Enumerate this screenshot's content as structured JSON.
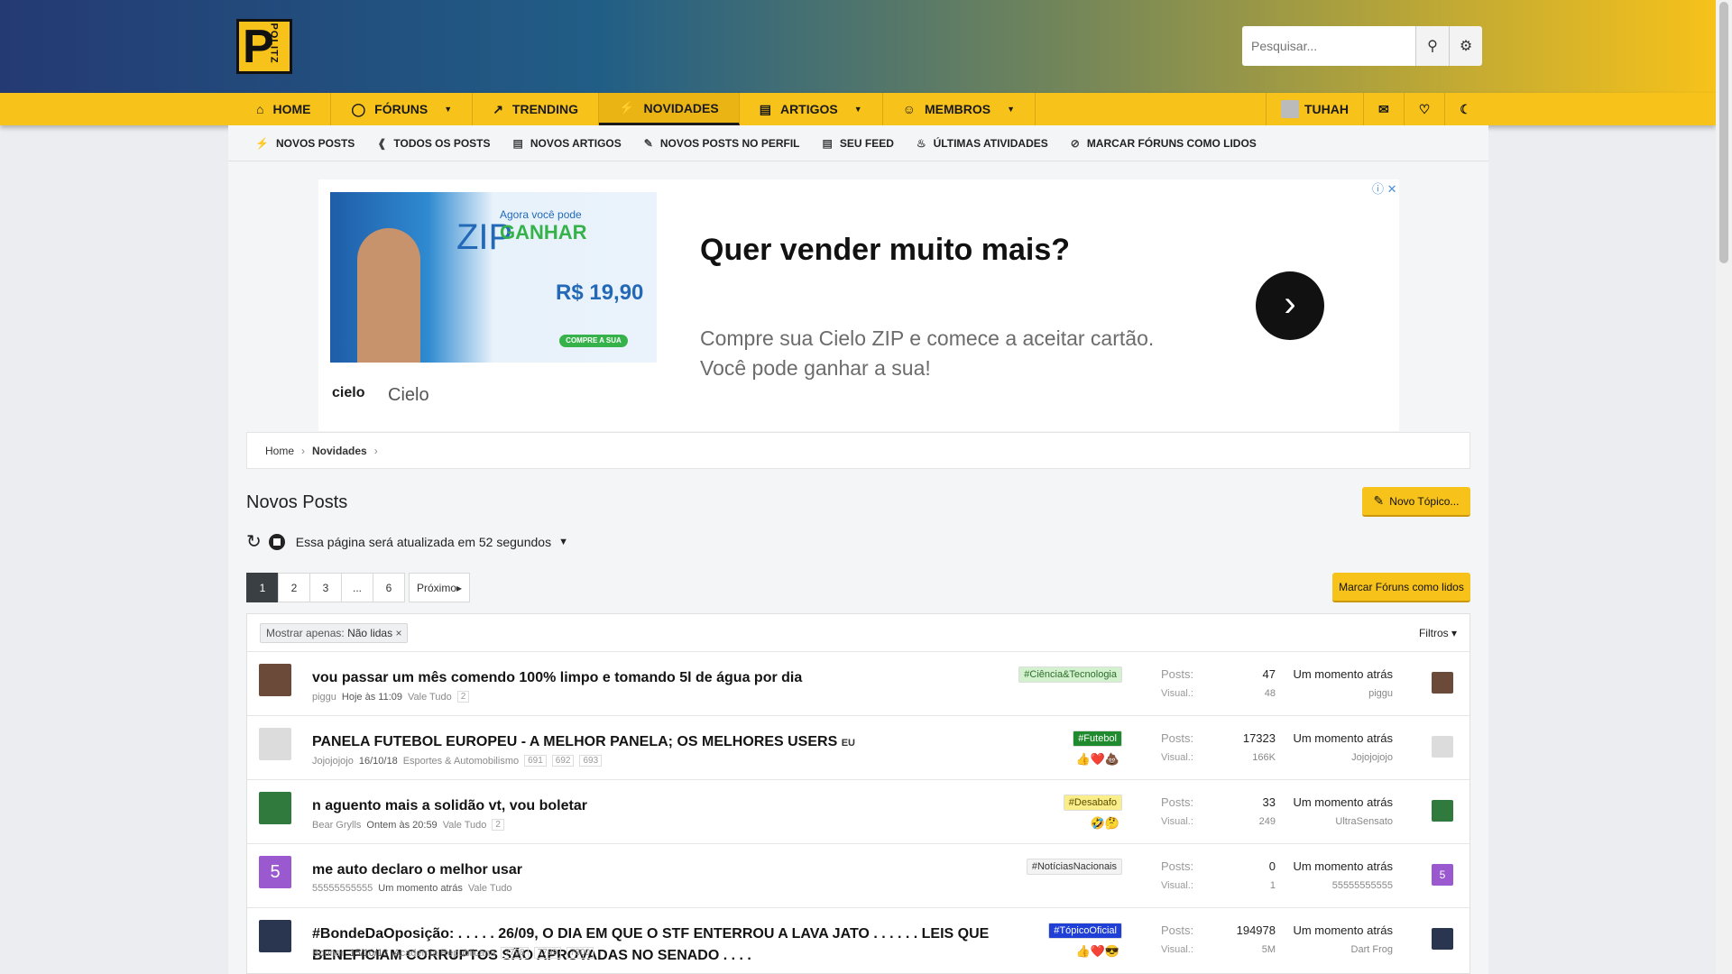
{
  "header": {
    "logo_letter": "P",
    "logo_text": "POLITZ",
    "search_placeholder": "Pesquisar...",
    "gradient_colors": [
      "#243a73",
      "#215e86",
      "#f7c21a"
    ]
  },
  "nav": {
    "items": [
      {
        "label": "HOME",
        "icon": "home-icon"
      },
      {
        "label": "FÓRUNS",
        "icon": "chat-icon"
      },
      {
        "label": "TRENDING",
        "icon": "chart-icon"
      },
      {
        "label": "NOVIDADES",
        "icon": "bolt-icon"
      },
      {
        "label": "ARTIGOS",
        "icon": "document-icon"
      },
      {
        "label": "MEMBROS",
        "icon": "users-icon"
      }
    ],
    "user": "TUHAH"
  },
  "subnav": [
    "NOVOS POSTS",
    "TODOS OS POSTS",
    "NOVOS ARTIGOS",
    "NOVOS POSTS NO PERFIL",
    "SEU FEED",
    "ÚLTIMAS ATIVIDADES",
    "MARCAR FÓRUNS COMO LIDOS"
  ],
  "ad": {
    "title": "Quer vender muito mais?",
    "description": "Compre sua Cielo ZIP e comece a aceitar cartão. Você pode ganhar a sua!",
    "brand_logo": "cielo",
    "brand": "Cielo",
    "img_zip": "ZIP",
    "img_line1": "Agora você pode",
    "img_ganhar": "GANHAR",
    "img_price": "R$ 19,90",
    "img_button": "COMPRE A SUA"
  },
  "breadcrumb": {
    "home": "Home",
    "current": "Novidades"
  },
  "page": {
    "title": "Novos Posts",
    "new_topic": "Novo Tópico...",
    "refresh_text": "Essa página será atualizada em 52 segundos",
    "mark_read": "Marcar Fóruns como lidos"
  },
  "pager": {
    "pages": [
      "1",
      "2",
      "3",
      "...",
      "6"
    ],
    "next": "Próximo"
  },
  "filterbar": {
    "label": "Mostrar apenas:",
    "value": "Não lidas",
    "filters": "Filtros"
  },
  "stat_labels": {
    "posts": "Posts:",
    "views": "Visual.:"
  },
  "threads": [
    {
      "title": "vou passar um mês comendo 100% limpo e tomando 5l de água por dia",
      "suffix": "",
      "author": "piggu",
      "date": "Hoje às 11:09",
      "forum": "Vale Tudo",
      "pages": [
        "2"
      ],
      "tag": "#Ciência&Tecnologia",
      "tag_bg": "#d4f1cf",
      "tag_color": "#2c6e2a",
      "reactions": "",
      "posts": "47",
      "views": "48",
      "last_time": "Um momento atrás",
      "last_user": "piggu",
      "avatar_color": "#6b4a3a"
    },
    {
      "title": "PANELA FUTEBOL EUROPEU - A MELHOR PANELA; OS MELHORES USERS",
      "suffix": "EU",
      "author": "Jojojojojo",
      "date": "16/10/18",
      "forum": "Esportes & Automobilismo",
      "pages": [
        "691",
        "692",
        "693"
      ],
      "tag": "#Futebol",
      "tag_bg": "#1f8a2e",
      "tag_color": "#ffffff",
      "reactions": "👍❤️💩",
      "posts": "17323",
      "views": "166K",
      "last_time": "Um momento atrás",
      "last_user": "Jojojojojo",
      "avatar_color": "#dcdcdc"
    },
    {
      "title": "n aguento mais a solidão vt, vou boletar",
      "suffix": "",
      "author": "Bear Grylls",
      "date": "Ontem às 20:59",
      "forum": "Vale Tudo",
      "pages": [
        "2"
      ],
      "tag": "#Desabafo",
      "tag_bg": "#f9ee8a",
      "tag_color": "#5a4d00",
      "reactions": "🤣🤔",
      "posts": "33",
      "views": "249",
      "last_time": "Um momento atrás",
      "last_user": "UltraSensato",
      "avatar_color": "#2f7a3c"
    },
    {
      "title": "me auto declaro o melhor usar",
      "suffix": "",
      "author": "55555555555",
      "date": "Um momento atrás",
      "forum": "Vale Tudo",
      "pages": [],
      "tag": "#NotíciasNacionais",
      "tag_bg": "#f3f3f3",
      "tag_color": "#333333",
      "reactions": "",
      "posts": "0",
      "views": "1",
      "last_time": "Um momento atrás",
      "last_user": "55555555555",
      "avatar_color": "#9b59d0",
      "avatar_letter": "5"
    },
    {
      "title": "#BondeDaOposição: . . . . . 26/09, O DIA EM QUE O STF ENTERROU A LAVA JATO . . . . . . LEIS QUE BENEFICIAM CORRUPTOS SÃO APROVADAS NO SENADO . . . .",
      "suffix": "",
      "author": "Bonner",
      "date": "15/10/18",
      "forum": "Academia Republicana",
      "pages": [
        "7798",
        "7799",
        "7800"
      ],
      "tag": "#TópicoOficial",
      "tag_bg": "#1f3fd6",
      "tag_color": "#ffffff",
      "reactions": "👍❤️😎",
      "posts": "194978",
      "views": "5M",
      "last_time": "Um momento atrás",
      "last_user": "Dart Frog",
      "avatar_color": "#2a3550"
    }
  ]
}
